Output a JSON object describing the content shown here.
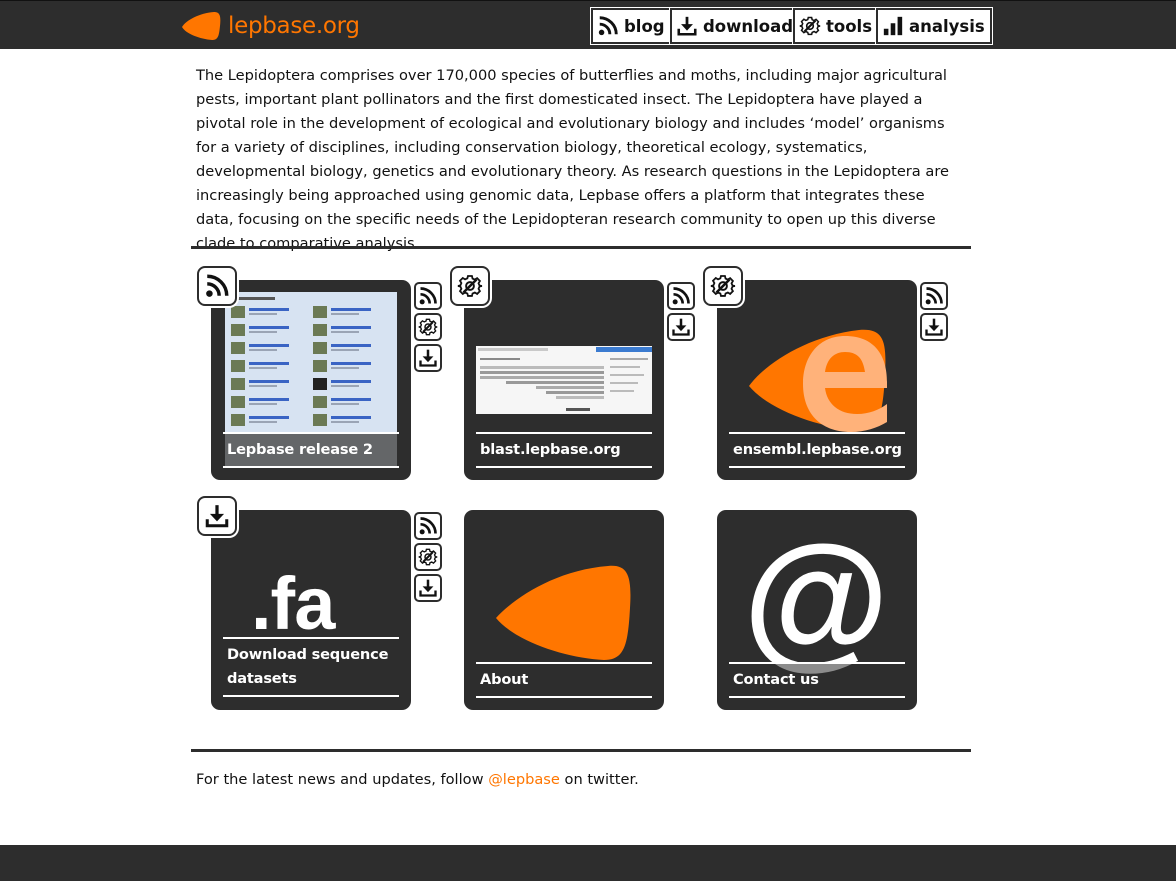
{
  "header": {
    "brand": "lepbase.org",
    "nav": [
      {
        "label": "blog",
        "icon": "rss-icon"
      },
      {
        "label": "download",
        "icon": "download-icon"
      },
      {
        "label": "tools",
        "icon": "gear-icon"
      },
      {
        "label": "analysis",
        "icon": "bar-chart-icon"
      }
    ]
  },
  "intro": "The Lepidoptera comprises over 170,000 species of butterflies and moths, including major agricultural pests, important plant pollinators and the first domesticated insect. The Lepidoptera have played a pivotal role in the development of ecological and evolutionary biology and includes ‘model’ organisms for a variety of disciplines, including conservation biology, theoretical ecology, systematics, developmental biology, genetics and evolutionary theory. As research questions in the Lepidoptera are increasingly being approached using genomic data, Lepbase offers a platform that integrates these data, focusing on the specific needs of the Lepidopteran research community to open up this diverse clade to comparative analysis.",
  "tiles": [
    {
      "label": "Lepbase release 2",
      "badge": "rss-icon",
      "side_icons": [
        "rss-icon",
        "gear-icon",
        "download-icon"
      ]
    },
    {
      "label": "blast.lepbase.org",
      "badge": "gear-icon",
      "side_icons": [
        "rss-icon",
        "download-icon"
      ]
    },
    {
      "label": "ensembl.lepbase.org",
      "badge": "gear-icon",
      "side_icons": [
        "rss-icon",
        "download-icon"
      ]
    },
    {
      "label": "Download sequence datasets",
      "badge": "download-icon",
      "side_icons": [
        "rss-icon",
        "gear-icon",
        "download-icon"
      ],
      "thumb_text": ".fa"
    },
    {
      "label": "About"
    },
    {
      "label": "Contact us",
      "thumb_text": "@"
    }
  ],
  "footer": {
    "prefix": "For the latest news and updates, follow ",
    "link": "@lepbase",
    "suffix": " on twitter."
  },
  "colors": {
    "accent": "#ff7600",
    "dark": "#2d2d2d"
  }
}
